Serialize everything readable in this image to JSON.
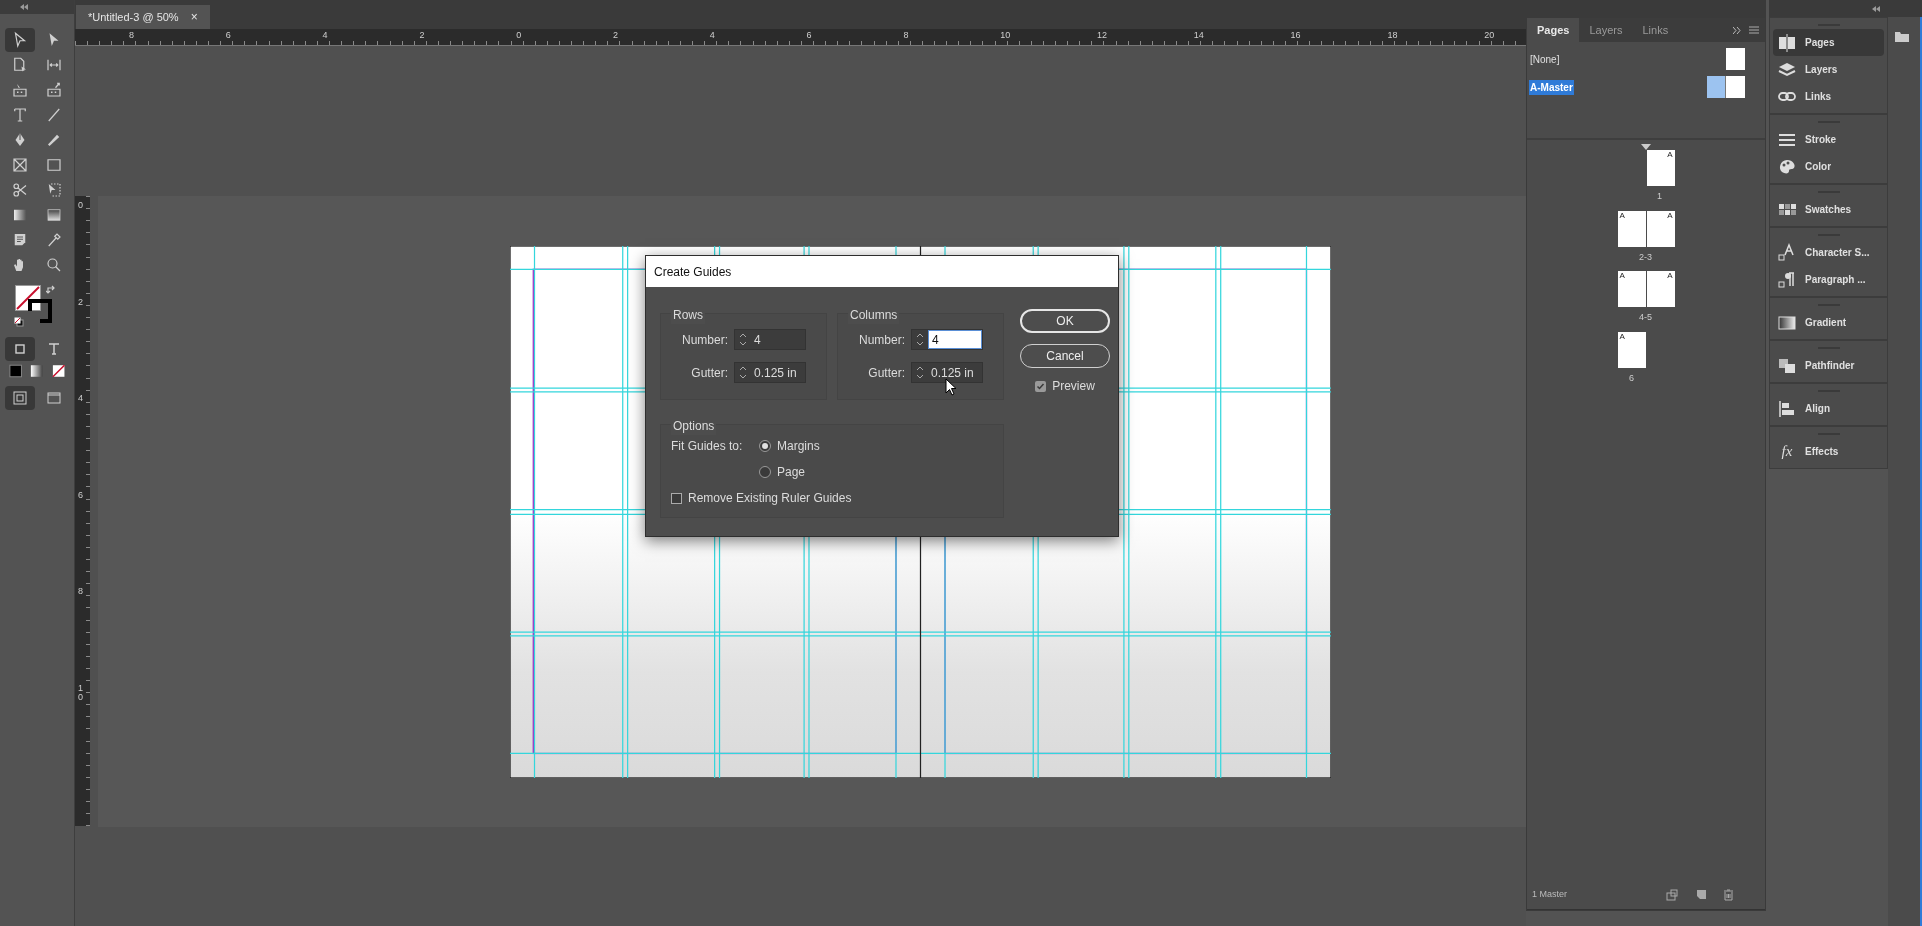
{
  "tools": [
    {
      "selected": true
    },
    {
      "selected": false
    },
    {
      "selected": false
    },
    {
      "selected": false
    },
    {
      "selected": false
    },
    {
      "selected": false
    },
    {
      "selected": false
    },
    {
      "selected": false
    },
    {
      "selected": false
    },
    {
      "selected": false
    },
    {
      "selected": false
    },
    {
      "selected": false
    },
    {
      "selected": false
    },
    {
      "selected": false
    },
    {
      "selected": false
    },
    {
      "selected": false
    },
    {
      "selected": false
    },
    {
      "selected": false
    },
    {
      "selected": false
    },
    {
      "selected": false
    }
  ],
  "formatting": [
    {
      "selected": true
    },
    {
      "selected": false
    }
  ],
  "modes": [
    {
      "selected": true
    },
    {
      "selected": false
    }
  ],
  "document_tab": {
    "title": "*Untitled-3 @ 50%",
    "close": "×"
  },
  "ruler": {
    "horizontal": [
      "8",
      "6",
      "4",
      "2",
      "0",
      "2",
      "4",
      "6",
      "8",
      "10",
      "12",
      "14",
      "16",
      "18",
      "20"
    ],
    "vertical": [
      "0",
      "2",
      "4",
      "6",
      "8",
      "10"
    ]
  },
  "dialog": {
    "title": "Create Guides",
    "groups": [
      {
        "legend": "Rows",
        "number_label": "Number:",
        "number": "4",
        "gutter_label": "Gutter:",
        "gutter": "0.125 in",
        "focused": false
      },
      {
        "legend": "Columns",
        "number_label": "Number:",
        "number": "4",
        "gutter_label": "Gutter:",
        "gutter": "0.125 in",
        "focused": true
      }
    ],
    "options": {
      "legend": "Options",
      "fit_label": "Fit Guides to:",
      "choices": [
        {
          "label": "Margins",
          "selected": true
        },
        {
          "label": "Page",
          "selected": false
        }
      ],
      "remove_guides": {
        "label": "Remove Existing Ruler Guides",
        "checked": false
      }
    },
    "buttons": [
      {
        "label": "OK",
        "kind": "default"
      },
      {
        "label": "Cancel",
        "kind": "normal"
      }
    ],
    "preview": {
      "label": "Preview",
      "checked": true
    }
  },
  "pages_panel": {
    "tabs": [
      {
        "label": "Pages",
        "selected": true
      },
      {
        "label": "Layers",
        "selected": false
      },
      {
        "label": "Links",
        "selected": false
      }
    ],
    "masters": [
      {
        "label": "[None]",
        "selected": false
      },
      {
        "label": "A-Master",
        "selected": true
      }
    ],
    "pages": [
      {
        "label": "1",
        "right": "A"
      },
      {
        "label": "2-3",
        "left": "A",
        "right": "A"
      },
      {
        "label": "4-5",
        "left": "A",
        "right": "A"
      },
      {
        "label": "6",
        "left": "A"
      }
    ],
    "footer": "1 Master"
  },
  "dock": {
    "groups": [
      {
        "items": [
          {
            "label": "Pages",
            "selected": true
          },
          {
            "label": "Layers",
            "selected": false
          },
          {
            "label": "Links",
            "selected": false
          }
        ]
      },
      {
        "items": [
          {
            "label": "Stroke",
            "selected": false
          },
          {
            "label": "Color",
            "selected": false
          }
        ]
      },
      {
        "items": [
          {
            "label": "Swatches",
            "selected": false
          }
        ]
      },
      {
        "items": [
          {
            "label": "Character S...",
            "selected": false
          },
          {
            "label": "Paragraph ...",
            "selected": false
          }
        ]
      },
      {
        "items": [
          {
            "label": "Gradient",
            "selected": false
          }
        ]
      },
      {
        "items": [
          {
            "label": "Pathfinder",
            "selected": false
          }
        ]
      },
      {
        "items": [
          {
            "label": "Align",
            "selected": false
          }
        ]
      },
      {
        "items": [
          {
            "label": "Effects",
            "glyph": "fx",
            "selected": false
          }
        ]
      }
    ]
  }
}
